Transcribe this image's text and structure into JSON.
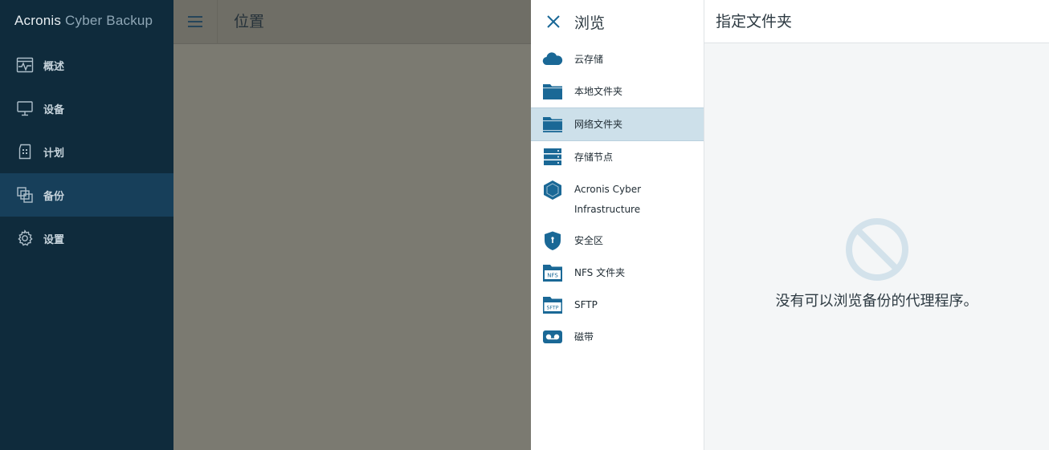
{
  "app": {
    "brand_primary": "Acronis",
    "brand_secondary": "Cyber Backup"
  },
  "sidebar": {
    "items": [
      {
        "label": "概述",
        "icon": "overview-icon"
      },
      {
        "label": "设备",
        "icon": "monitor-icon"
      },
      {
        "label": "计划",
        "icon": "plan-icon"
      },
      {
        "label": "备份",
        "icon": "backup-icon",
        "active": true
      },
      {
        "label": "设置",
        "icon": "gear-icon"
      }
    ]
  },
  "header": {
    "title": "位置"
  },
  "browse": {
    "title": "浏览",
    "items": [
      {
        "label": "云存储",
        "icon": "cloud-icon"
      },
      {
        "label": "本地文件夹",
        "icon": "folder-icon"
      },
      {
        "label": "网络文件夹",
        "icon": "network-folder-icon",
        "selected": true
      },
      {
        "label": "存储节点",
        "icon": "storage-node-icon"
      },
      {
        "label_line1": "Acronis Cyber",
        "label_line2": "Infrastructure",
        "icon": "cube-icon"
      },
      {
        "label": "安全区",
        "icon": "shield-icon"
      },
      {
        "label": "NFS 文件夹",
        "icon": "nfs-folder-icon",
        "badge": "NFS"
      },
      {
        "label": "SFTP",
        "icon": "sftp-folder-icon",
        "badge": "SFTP"
      },
      {
        "label": "磁带",
        "icon": "tape-icon"
      }
    ]
  },
  "folder_panel": {
    "title": "指定文件夹",
    "empty_message": "没有可以浏览备份的代理程序。"
  },
  "colors": {
    "sidebar_bg": "#0f2b3c",
    "sidebar_active": "#173f5a",
    "accent": "#1a6896",
    "selected_row": "#cde0ea",
    "empty_icon": "#d3e2eb"
  }
}
